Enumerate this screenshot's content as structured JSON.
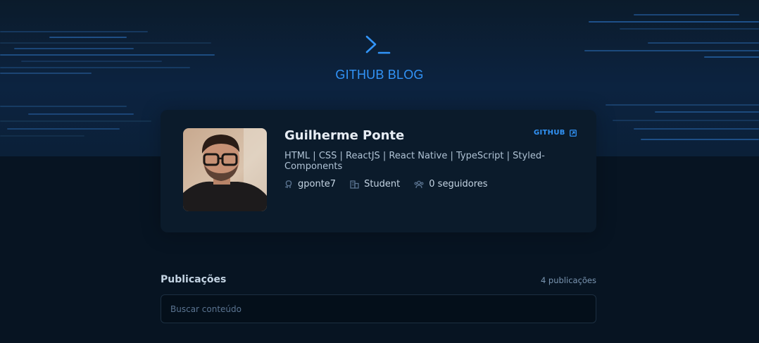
{
  "header": {
    "logo_icon": "terminal-prompt-icon",
    "logo_text": "GITHUB BLOG"
  },
  "profile": {
    "name": "Guilherme Ponte",
    "bio": "HTML | CSS | ReactJS | React Native | TypeScript | Styled-Components",
    "github_label": "GITHUB",
    "github_icon": "external-link-icon",
    "username": "gponte7",
    "company": "Student",
    "followers": "0 seguidores",
    "username_icon": "github-icon",
    "company_icon": "building-icon",
    "followers_icon": "users-icon"
  },
  "publications": {
    "title": "Publicações",
    "count": "4 publicações",
    "search_placeholder": "Buscar conteúdo"
  },
  "colors": {
    "accent": "#3294f8",
    "background": "#071422",
    "card": "#0b1b2b",
    "input_border": "#1c2f41"
  }
}
